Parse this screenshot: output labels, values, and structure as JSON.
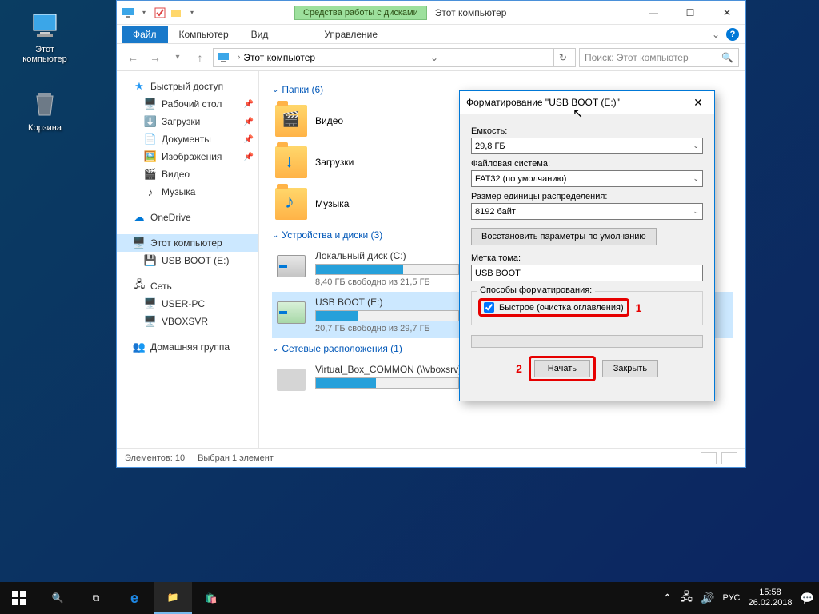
{
  "desktop": {
    "this_pc": "Этот компьютер",
    "recycle": "Корзина"
  },
  "explorer": {
    "drivetools": "Средства работы с дисками",
    "title": "Этот компьютер",
    "tabs": {
      "file": "Файл",
      "computer": "Компьютер",
      "view": "Вид",
      "manage": "Управление"
    },
    "address": "Этот компьютер",
    "search_placeholder": "Поиск: Этот компьютер",
    "sidebar": {
      "quick": "Быстрый доступ",
      "desktop": "Рабочий стол",
      "downloads": "Загрузки",
      "documents": "Документы",
      "pictures": "Изображения",
      "video": "Видео",
      "music": "Музыка",
      "onedrive": "OneDrive",
      "this_pc": "Этот компьютер",
      "usb": "USB BOOT (E:)",
      "network": "Сеть",
      "userpc": "USER-PC",
      "vboxsvr": "VBOXSVR",
      "homegroup": "Домашняя группа"
    },
    "groups": {
      "folders": "Папки (6)",
      "drives": "Устройства и диски (3)",
      "network": "Сетевые расположения (1)"
    },
    "folders": {
      "video": "Видео",
      "downloads": "Загрузки",
      "music": "Музыка"
    },
    "drives": {
      "c": {
        "name": "Локальный диск (C:)",
        "free": "8,40 ГБ свободно из 21,5 ГБ",
        "fill": 61
      },
      "e": {
        "name": "USB BOOT (E:)",
        "free": "20,7 ГБ свободно из 29,7 ГБ",
        "fill": 30
      }
    },
    "netloc": {
      "name": "Virtual_Box_COMMON (\\\\vboxsrv) (F:)",
      "fill": 42
    },
    "status": {
      "items": "Элементов: 10",
      "selected": "Выбран 1 элемент"
    }
  },
  "dialog": {
    "title": "Форматирование \"USB BOOT (E:)\"",
    "capacity_label": "Емкость:",
    "capacity_value": "29,8 ГБ",
    "fs_label": "Файловая система:",
    "fs_value": "FAT32 (по умолчанию)",
    "alloc_label": "Размер единицы распределения:",
    "alloc_value": "8192 байт",
    "restore": "Восстановить параметры по умолчанию",
    "volume_label": "Метка тома:",
    "volume_value": "USB BOOT",
    "methods": "Способы форматирования:",
    "quick": "Быстрое (очистка оглавления)",
    "annot1": "1",
    "annot2": "2",
    "start": "Начать",
    "close": "Закрыть"
  },
  "taskbar": {
    "lang": "РУС",
    "time": "15:58",
    "date": "26.02.2018"
  }
}
